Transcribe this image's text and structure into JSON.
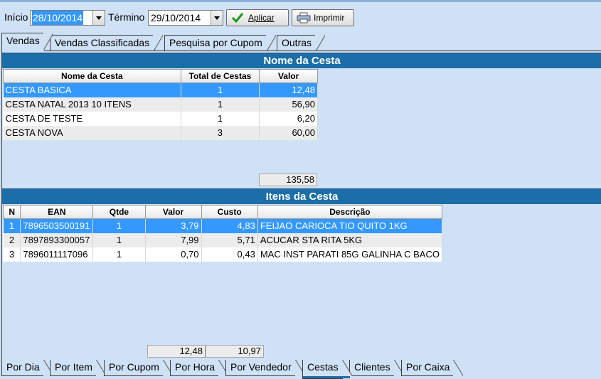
{
  "toolbar": {
    "start_label": "Início",
    "start_value": "28/10/2014",
    "end_label": "Término",
    "end_value": "29/10/2014",
    "apply_label": "Aplicar",
    "print_label": "Imprimir"
  },
  "top_tabs": [
    "Vendas",
    "Vendas Classificadas",
    "Pesquisa por Cupom",
    "Outras"
  ],
  "baskets": {
    "title": "Nome da Cesta",
    "columns": [
      "Nome da Cesta",
      "Total de Cestas",
      "Valor"
    ],
    "rows": [
      [
        "CESTA BASICA",
        "1",
        "12,48"
      ],
      [
        "CESTA NATAL 2013 10 ITENS",
        "1",
        "56,90"
      ],
      [
        "CESTA DE TESTE",
        "1",
        "6,20"
      ],
      [
        "CESTA NOVA",
        "3",
        "60,00"
      ]
    ],
    "total": "135,58"
  },
  "items": {
    "title": "Itens da Cesta",
    "columns": [
      "N",
      "EAN",
      "Qtde",
      "Valor",
      "Custo",
      "Descrição"
    ],
    "rows": [
      [
        "1",
        "7896503500191",
        "1",
        "3,79",
        "4,83",
        "FEIJAO CARIOCA TIO QUITO 1KG"
      ],
      [
        "2",
        "7897893300057",
        "1",
        "7,99",
        "5,71",
        "ACUCAR STA RITA 5KG"
      ],
      [
        "3",
        "7896011117096",
        "1",
        "0,70",
        "0,43",
        "MAC INST PARATI 85G GALINHA C BACO"
      ]
    ],
    "total_valor": "12,48",
    "total_custo": "10,97"
  },
  "bottom_tabs": [
    "Por Dia",
    "Por Item",
    "Por Cupom",
    "Por Hora",
    "Por Vendedor",
    "Cestas",
    "Clientes",
    "Por Caixa"
  ],
  "colors": {
    "header_blue": "#1c6ea8",
    "selection": "#3399ff",
    "background": "#cfe1f5"
  }
}
